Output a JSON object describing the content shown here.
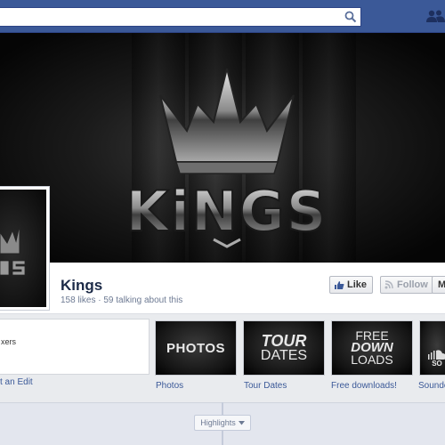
{
  "header": {
    "search_placeholder": ""
  },
  "page": {
    "name": "Kings",
    "stats": "158 likes · 59 talking about this",
    "cover_logo_text": "KiNGS"
  },
  "actions": {
    "like_label": "Like",
    "follow_label": "Follow",
    "more_label": "M"
  },
  "about": {
    "text": "xers",
    "link": "t an Edit"
  },
  "apps": [
    {
      "tile_text": "PHOTOS",
      "label": "Photos"
    },
    {
      "tile_text_1": "TOUR",
      "tile_text_2": "DATES",
      "label": "Tour Dates"
    },
    {
      "tile_text_1": "FREE",
      "tile_text_2": "DOWN",
      "tile_text_3": "LOADS",
      "label": "Free downloads!"
    },
    {
      "tile_text": "SO",
      "label": "Soundc"
    }
  ],
  "timeline": {
    "highlights_label": "Highlights"
  },
  "colors": {
    "brand_blue": "#3b5998",
    "link_blue": "#3b5998"
  }
}
